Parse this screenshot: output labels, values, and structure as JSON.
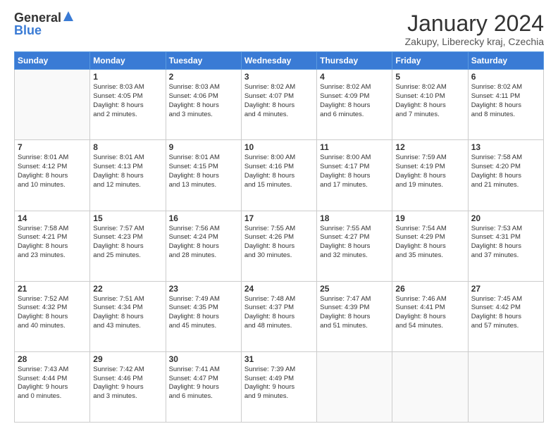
{
  "logo": {
    "general": "General",
    "blue": "Blue"
  },
  "title": "January 2024",
  "location": "Zakupy, Liberecky kraj, Czechia",
  "header_days": [
    "Sunday",
    "Monday",
    "Tuesday",
    "Wednesday",
    "Thursday",
    "Friday",
    "Saturday"
  ],
  "weeks": [
    [
      {
        "day": "",
        "lines": []
      },
      {
        "day": "1",
        "lines": [
          "Sunrise: 8:03 AM",
          "Sunset: 4:05 PM",
          "Daylight: 8 hours",
          "and 2 minutes."
        ]
      },
      {
        "day": "2",
        "lines": [
          "Sunrise: 8:03 AM",
          "Sunset: 4:06 PM",
          "Daylight: 8 hours",
          "and 3 minutes."
        ]
      },
      {
        "day": "3",
        "lines": [
          "Sunrise: 8:02 AM",
          "Sunset: 4:07 PM",
          "Daylight: 8 hours",
          "and 4 minutes."
        ]
      },
      {
        "day": "4",
        "lines": [
          "Sunrise: 8:02 AM",
          "Sunset: 4:09 PM",
          "Daylight: 8 hours",
          "and 6 minutes."
        ]
      },
      {
        "day": "5",
        "lines": [
          "Sunrise: 8:02 AM",
          "Sunset: 4:10 PM",
          "Daylight: 8 hours",
          "and 7 minutes."
        ]
      },
      {
        "day": "6",
        "lines": [
          "Sunrise: 8:02 AM",
          "Sunset: 4:11 PM",
          "Daylight: 8 hours",
          "and 8 minutes."
        ]
      }
    ],
    [
      {
        "day": "7",
        "lines": [
          "Sunrise: 8:01 AM",
          "Sunset: 4:12 PM",
          "Daylight: 8 hours",
          "and 10 minutes."
        ]
      },
      {
        "day": "8",
        "lines": [
          "Sunrise: 8:01 AM",
          "Sunset: 4:13 PM",
          "Daylight: 8 hours",
          "and 12 minutes."
        ]
      },
      {
        "day": "9",
        "lines": [
          "Sunrise: 8:01 AM",
          "Sunset: 4:15 PM",
          "Daylight: 8 hours",
          "and 13 minutes."
        ]
      },
      {
        "day": "10",
        "lines": [
          "Sunrise: 8:00 AM",
          "Sunset: 4:16 PM",
          "Daylight: 8 hours",
          "and 15 minutes."
        ]
      },
      {
        "day": "11",
        "lines": [
          "Sunrise: 8:00 AM",
          "Sunset: 4:17 PM",
          "Daylight: 8 hours",
          "and 17 minutes."
        ]
      },
      {
        "day": "12",
        "lines": [
          "Sunrise: 7:59 AM",
          "Sunset: 4:19 PM",
          "Daylight: 8 hours",
          "and 19 minutes."
        ]
      },
      {
        "day": "13",
        "lines": [
          "Sunrise: 7:58 AM",
          "Sunset: 4:20 PM",
          "Daylight: 8 hours",
          "and 21 minutes."
        ]
      }
    ],
    [
      {
        "day": "14",
        "lines": [
          "Sunrise: 7:58 AM",
          "Sunset: 4:21 PM",
          "Daylight: 8 hours",
          "and 23 minutes."
        ]
      },
      {
        "day": "15",
        "lines": [
          "Sunrise: 7:57 AM",
          "Sunset: 4:23 PM",
          "Daylight: 8 hours",
          "and 25 minutes."
        ]
      },
      {
        "day": "16",
        "lines": [
          "Sunrise: 7:56 AM",
          "Sunset: 4:24 PM",
          "Daylight: 8 hours",
          "and 28 minutes."
        ]
      },
      {
        "day": "17",
        "lines": [
          "Sunrise: 7:55 AM",
          "Sunset: 4:26 PM",
          "Daylight: 8 hours",
          "and 30 minutes."
        ]
      },
      {
        "day": "18",
        "lines": [
          "Sunrise: 7:55 AM",
          "Sunset: 4:27 PM",
          "Daylight: 8 hours",
          "and 32 minutes."
        ]
      },
      {
        "day": "19",
        "lines": [
          "Sunrise: 7:54 AM",
          "Sunset: 4:29 PM",
          "Daylight: 8 hours",
          "and 35 minutes."
        ]
      },
      {
        "day": "20",
        "lines": [
          "Sunrise: 7:53 AM",
          "Sunset: 4:31 PM",
          "Daylight: 8 hours",
          "and 37 minutes."
        ]
      }
    ],
    [
      {
        "day": "21",
        "lines": [
          "Sunrise: 7:52 AM",
          "Sunset: 4:32 PM",
          "Daylight: 8 hours",
          "and 40 minutes."
        ]
      },
      {
        "day": "22",
        "lines": [
          "Sunrise: 7:51 AM",
          "Sunset: 4:34 PM",
          "Daylight: 8 hours",
          "and 43 minutes."
        ]
      },
      {
        "day": "23",
        "lines": [
          "Sunrise: 7:49 AM",
          "Sunset: 4:35 PM",
          "Daylight: 8 hours",
          "and 45 minutes."
        ]
      },
      {
        "day": "24",
        "lines": [
          "Sunrise: 7:48 AM",
          "Sunset: 4:37 PM",
          "Daylight: 8 hours",
          "and 48 minutes."
        ]
      },
      {
        "day": "25",
        "lines": [
          "Sunrise: 7:47 AM",
          "Sunset: 4:39 PM",
          "Daylight: 8 hours",
          "and 51 minutes."
        ]
      },
      {
        "day": "26",
        "lines": [
          "Sunrise: 7:46 AM",
          "Sunset: 4:41 PM",
          "Daylight: 8 hours",
          "and 54 minutes."
        ]
      },
      {
        "day": "27",
        "lines": [
          "Sunrise: 7:45 AM",
          "Sunset: 4:42 PM",
          "Daylight: 8 hours",
          "and 57 minutes."
        ]
      }
    ],
    [
      {
        "day": "28",
        "lines": [
          "Sunrise: 7:43 AM",
          "Sunset: 4:44 PM",
          "Daylight: 9 hours",
          "and 0 minutes."
        ]
      },
      {
        "day": "29",
        "lines": [
          "Sunrise: 7:42 AM",
          "Sunset: 4:46 PM",
          "Daylight: 9 hours",
          "and 3 minutes."
        ]
      },
      {
        "day": "30",
        "lines": [
          "Sunrise: 7:41 AM",
          "Sunset: 4:47 PM",
          "Daylight: 9 hours",
          "and 6 minutes."
        ]
      },
      {
        "day": "31",
        "lines": [
          "Sunrise: 7:39 AM",
          "Sunset: 4:49 PM",
          "Daylight: 9 hours",
          "and 9 minutes."
        ]
      },
      {
        "day": "",
        "lines": []
      },
      {
        "day": "",
        "lines": []
      },
      {
        "day": "",
        "lines": []
      }
    ]
  ]
}
